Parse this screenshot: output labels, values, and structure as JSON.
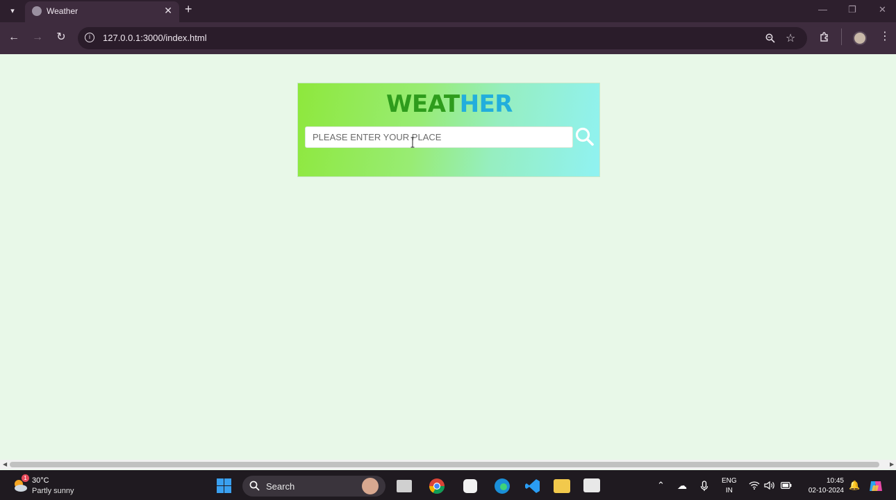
{
  "browser": {
    "tab_title": "Weather",
    "url": "127.0.0.1:3000/index.html"
  },
  "page": {
    "title_part1": "WEAT",
    "title_part2": "HER",
    "search_placeholder": "PLEASE ENTER YOUR PLACE",
    "search_icon": "search-icon"
  },
  "taskbar": {
    "weather_temp": "30°C",
    "weather_condition": "Partly sunny",
    "weather_badge": "1",
    "search_label": "Search",
    "lang_primary": "ENG",
    "lang_secondary": "IN",
    "time": "10:45",
    "date": "02-10-2024"
  },
  "colors": {
    "title_green": "#2e9c1c",
    "title_blue": "#22aedc",
    "page_bg": "#e8f8e8",
    "card_gradient_start": "#8ee83c",
    "card_gradient_end": "#90f2f2"
  }
}
